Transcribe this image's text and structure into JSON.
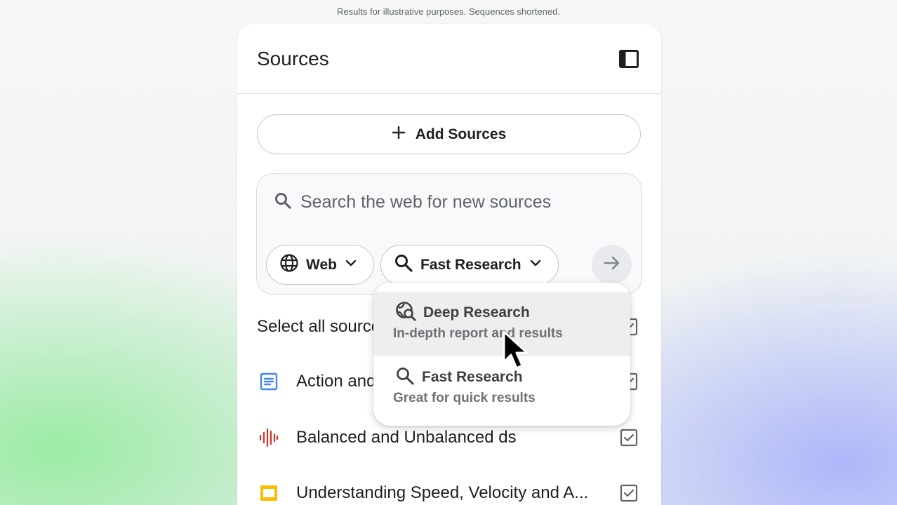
{
  "disclaimer": "Results for illustrative purposes. Sequences shortened.",
  "panel": {
    "title": "Sources",
    "add_sources_label": "Add Sources",
    "search": {
      "placeholder": "Search the web for new sources",
      "source_chip": "Web",
      "mode_chip": "Fast Research"
    },
    "select_all_label": "Select all sources",
    "sources": [
      {
        "title": "Action and Reaction",
        "icon": "document-icon",
        "color": "#4285f4",
        "checked": true
      },
      {
        "title": "Balanced and Unbalanced ds",
        "icon": "audio-icon",
        "color": "#d93025",
        "checked": true
      },
      {
        "title": "Understanding Speed, Velocity and A...",
        "icon": "slides-icon",
        "color": "#fbbc04",
        "checked": true
      }
    ]
  },
  "dropdown": {
    "items": [
      {
        "title": "Deep Research",
        "description": "In-depth report and results",
        "icon": "globe-search-icon",
        "highlighted": true
      },
      {
        "title": "Fast Research",
        "description": "Great for quick results",
        "icon": "search-icon",
        "highlighted": false
      }
    ]
  },
  "colors": {
    "accent_blue": "#4285f4",
    "audio_red": "#d93025",
    "slides_yellow": "#fbbc04"
  }
}
